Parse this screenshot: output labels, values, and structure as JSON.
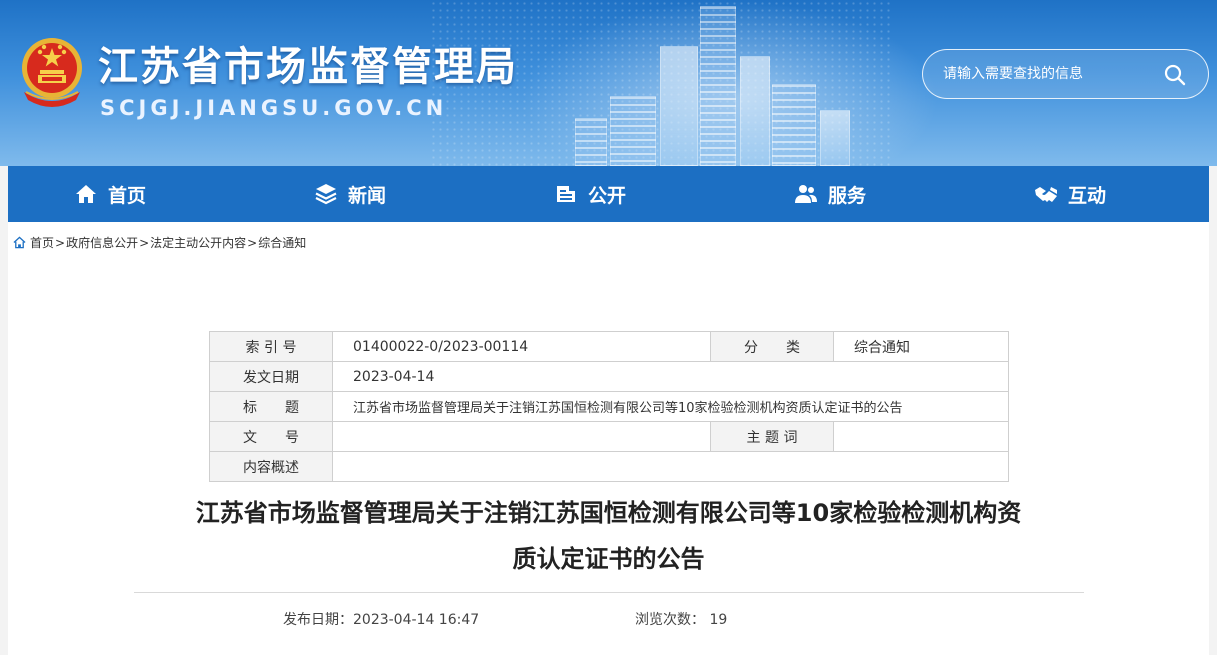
{
  "header": {
    "site_title": "江苏省市场监督管理局",
    "site_domain": "SCJGJ.JIANGSU.GOV.CN",
    "search_placeholder": "请输入需要查找的信息"
  },
  "nav": {
    "items": [
      {
        "label": "首页",
        "icon": "home-icon"
      },
      {
        "label": "新闻",
        "icon": "layers-icon"
      },
      {
        "label": "公开",
        "icon": "disclosure-icon"
      },
      {
        "label": "服务",
        "icon": "users-icon"
      },
      {
        "label": "互动",
        "icon": "handshake-icon"
      }
    ]
  },
  "breadcrumb": {
    "items": [
      "首页",
      "政府信息公开",
      "法定主动公开内容",
      "综合通知"
    ],
    "separator": ">"
  },
  "meta_table": {
    "index_label": "索 引 号",
    "index_value": "01400022-0/2023-00114",
    "category_label": "分　　类",
    "category_value": "综合通知",
    "date_label": "发文日期",
    "date_value": "2023-04-14",
    "title_label": "标　　题",
    "title_value": "江苏省市场监督管理局关于注销江苏国恒检测有限公司等10家检验检测机构资质认定证书的公告",
    "doc_no_label": "文　　号",
    "doc_no_value": "",
    "keywords_label": "主 题 词",
    "keywords_value": "",
    "summary_label": "内容概述",
    "summary_value": ""
  },
  "article": {
    "title_line1": "江苏省市场监督管理局关于注销江苏国恒检测有限公司等10家检验检测机构资",
    "title_line2": "质认定证书的公告",
    "publish_label": "发布日期：",
    "publish_value": "2023-04-14 16:47",
    "views_label": "浏览次数：",
    "views_value": "19"
  },
  "colors": {
    "header_blue": "#1f72c6",
    "nav_blue": "#1c6fc3",
    "table_label_bg": "#f3f3f3"
  }
}
